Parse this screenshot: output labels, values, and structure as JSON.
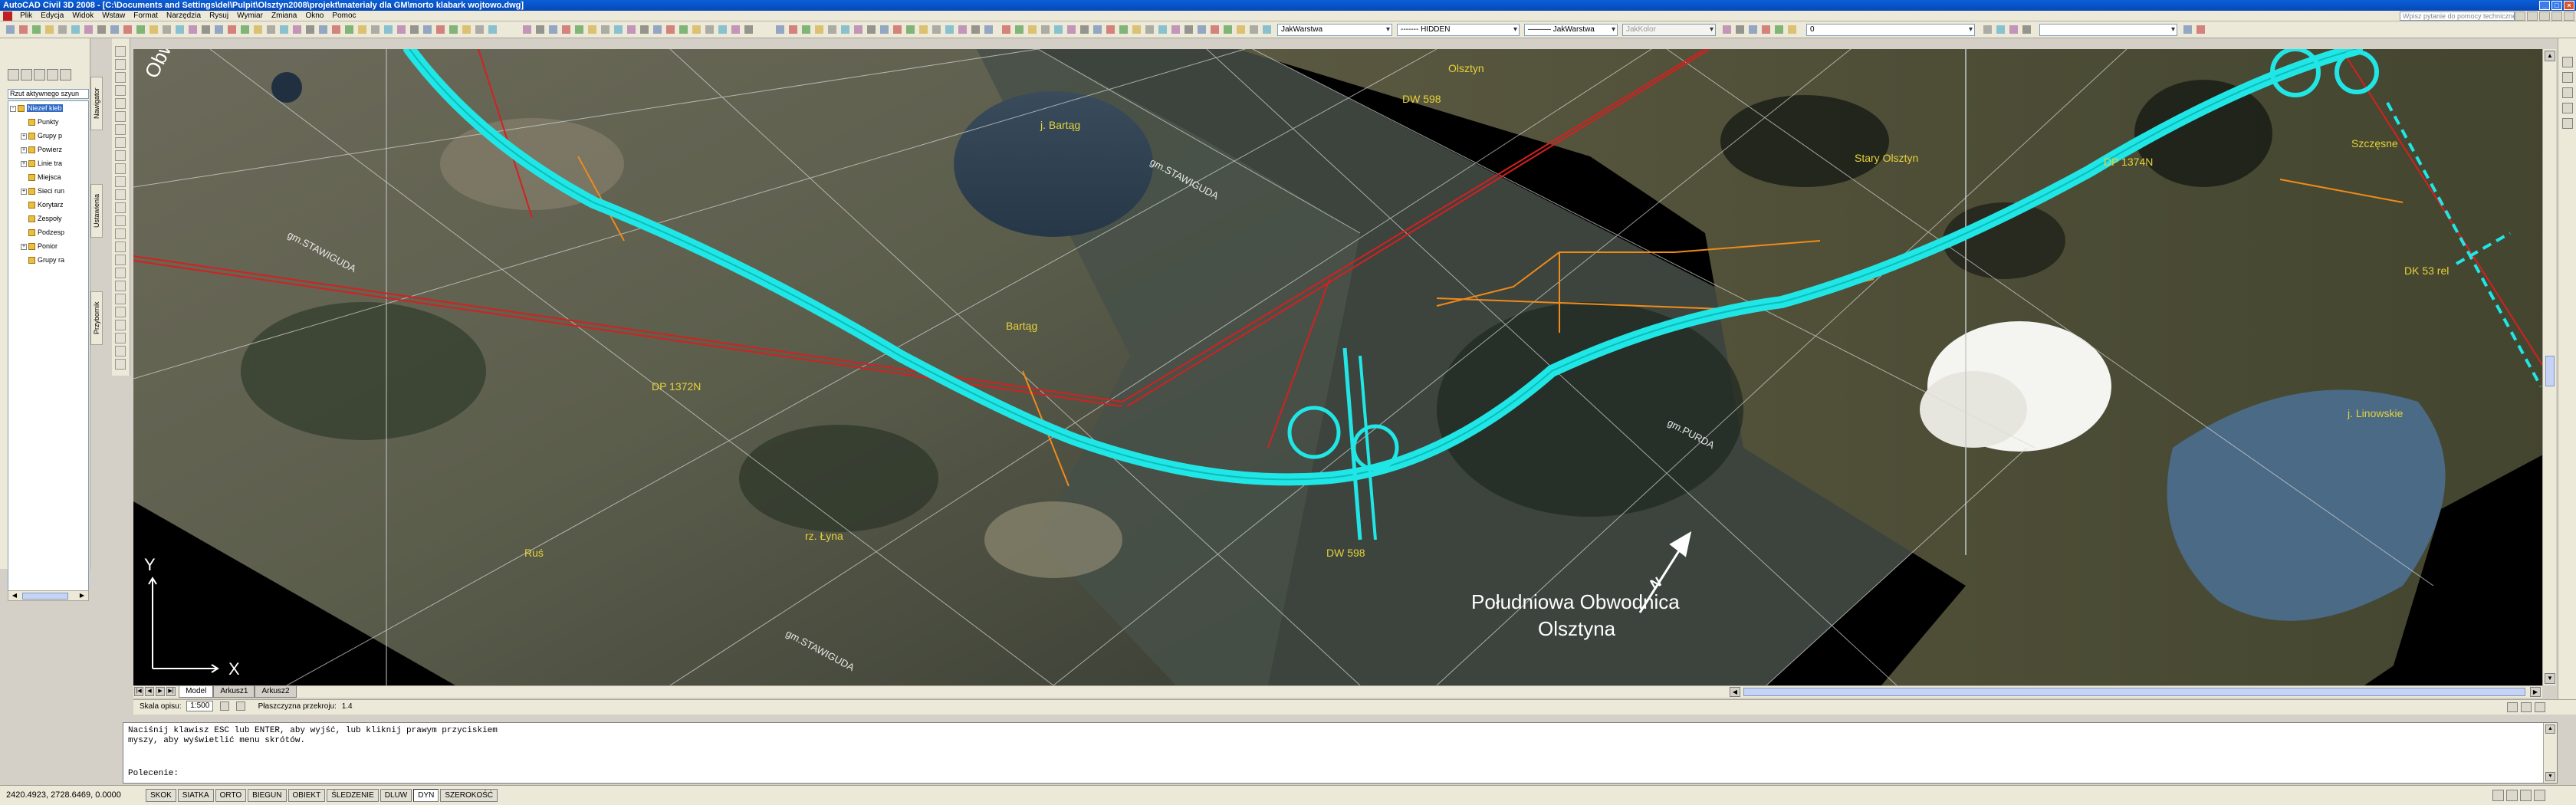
{
  "window": {
    "title": "AutoCAD Civil 3D 2008 - [C:\\Documents and Settings\\del\\Pulpit\\Olsztyn2008\\projekt\\materialy dla GM\\morto klabark wojtowo.dwg]",
    "help_search_placeholder": "Wpisz pytanie do pomocy technicznej"
  },
  "menu": [
    "Plik",
    "Edycja",
    "Widok",
    "Wstaw",
    "Format",
    "Narzędzia",
    "Rysuj",
    "Wymiar",
    "Zmiana",
    "Okno",
    "Pomoc"
  ],
  "toolbar": {
    "layer_color": "JakWarstwa",
    "linetype": "------- HIDDEN",
    "lineweight": "——— JakWarstwa",
    "plotstyle": "JakKolor",
    "layer_name": "0"
  },
  "left_panel": {
    "search_text": "Rzut aktywnego szyun",
    "tree": [
      {
        "label": "Niezef kleb",
        "selected": true,
        "expander": "-"
      },
      {
        "label": "Punkty",
        "selected": false,
        "expander": ""
      },
      {
        "label": "Grupy p",
        "selected": false,
        "expander": "+"
      },
      {
        "label": "Powierz",
        "selected": false,
        "expander": "+"
      },
      {
        "label": "Linie tra",
        "selected": false,
        "expander": "+"
      },
      {
        "label": "Miejsca",
        "selected": false,
        "expander": ""
      },
      {
        "label": "Sieci run",
        "selected": false,
        "expander": "+"
      },
      {
        "label": "Korytarz",
        "selected": false,
        "expander": ""
      },
      {
        "label": "Zespoły",
        "selected": false,
        "expander": ""
      },
      {
        "label": "Podzesp",
        "selected": false,
        "expander": ""
      },
      {
        "label": "Ponior",
        "selected": false,
        "expander": "+"
      },
      {
        "label": "Grupy ra",
        "selected": false,
        "expander": ""
      }
    ],
    "vtabs": {
      "navigator": "Nawigator",
      "settings": "Ustawienia",
      "toolbox": "Przybornik"
    }
  },
  "map_labels": {
    "road_big": "Obwodnica",
    "road_title_1": "Południowa Obwodnica",
    "road_title_2": "Olsztyna",
    "lake_bartag": "j. Bartąg",
    "village_bartag": "Bartąg",
    "dw598_top": "DW 598",
    "dw598_bottom": "DW 598",
    "dp1372n": "DP 1372N",
    "dp1374n": "DP 1374N",
    "olsztyn_arrow": "Olsztyn",
    "stary_olsztyn": "Stary Olsztyn",
    "szczesne": "Szczęsne",
    "dk53": "DK 53 rel",
    "lake_linowskie": "j. Linowskie",
    "river_lyna": "rz. Łyna",
    "ruszi": "Ruś",
    "gm_stawiguda_1": "gm.STAWIGUDA",
    "gm_stawiguda_2": "gm.STAWIGUDA",
    "gm_stawiguda_3": "gm.STAWIGUDA",
    "gm_purda": "gm.PURDA",
    "axis_x": "X",
    "axis_y": "Y",
    "north": "N"
  },
  "layout_tabs": [
    "Model",
    "Arkusz1",
    "Arkusz2"
  ],
  "annotation": {
    "scale_label": "Skala opisu:",
    "scale_value": "1:500",
    "section_label": "Płaszczyzna przekroju:",
    "section_value": "1.4"
  },
  "command": {
    "history": [
      "Naciśnij klawisz ESC lub ENTER, aby wyjść, lub kliknij prawym przyciskiem",
      "myszy, aby wyświetlić menu skrótów."
    ],
    "prompt": "Polecenie:",
    "value": ""
  },
  "status": {
    "coords": "2420.4923, 2728.6469, 0.0000",
    "toggles": [
      {
        "label": "SKOK",
        "on": false
      },
      {
        "label": "SIATKA",
        "on": false
      },
      {
        "label": "ORTO",
        "on": false
      },
      {
        "label": "BIEGUN",
        "on": false
      },
      {
        "label": "OBIEKT",
        "on": false
      },
      {
        "label": "ŚLEDZENIE",
        "on": false
      },
      {
        "label": "DLUW",
        "on": false
      },
      {
        "label": "DYN",
        "on": true
      },
      {
        "label": "SZEROKOŚĆ",
        "on": false
      }
    ]
  },
  "colors": {
    "road_cyan": "#21e6e6",
    "red_lines": "#d42020",
    "orange_lines": "#f08a1a",
    "label_yellow": "#e6d23a",
    "background": "#000000"
  }
}
